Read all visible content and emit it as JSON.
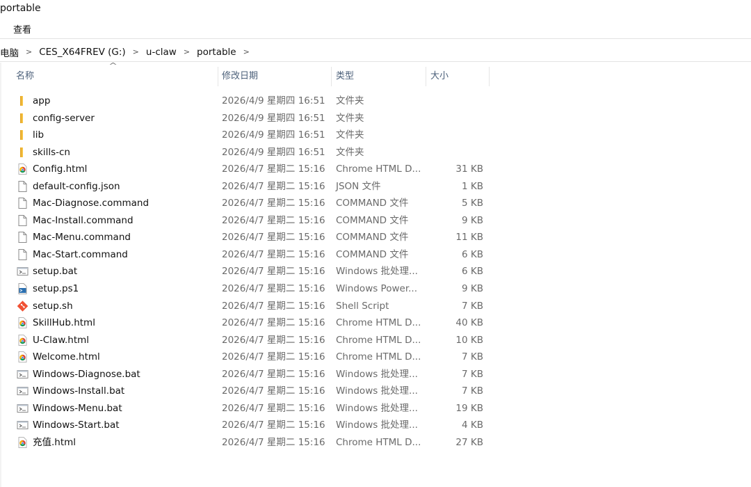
{
  "window": {
    "title": "portable"
  },
  "ribbon": {
    "view_tab": "查看"
  },
  "breadcrumb": [
    "电脑",
    "CES_X64FREV (G:)",
    "u-claw",
    "portable"
  ],
  "columns": {
    "name": "名称",
    "date": "修改日期",
    "type": "类型",
    "size": "大小"
  },
  "files": [
    {
      "name": "app",
      "date": "2026/4/9 星期四 16:51",
      "type": "文件夹",
      "size": "",
      "icon": "folder-icon"
    },
    {
      "name": "config-server",
      "date": "2026/4/9 星期四 16:51",
      "type": "文件夹",
      "size": "",
      "icon": "folder-icon"
    },
    {
      "name": "lib",
      "date": "2026/4/9 星期四 16:51",
      "type": "文件夹",
      "size": "",
      "icon": "folder-icon"
    },
    {
      "name": "skills-cn",
      "date": "2026/4/9 星期四 16:51",
      "type": "文件夹",
      "size": "",
      "icon": "folder-icon"
    },
    {
      "name": "Config.html",
      "date": "2026/4/7 星期二 15:16",
      "type": "Chrome HTML D...",
      "size": "31 KB",
      "icon": "chrome-icon"
    },
    {
      "name": "default-config.json",
      "date": "2026/4/7 星期二 15:16",
      "type": "JSON 文件",
      "size": "1 KB",
      "icon": "file-icon"
    },
    {
      "name": "Mac-Diagnose.command",
      "date": "2026/4/7 星期二 15:16",
      "type": "COMMAND 文件",
      "size": "5 KB",
      "icon": "file-icon"
    },
    {
      "name": "Mac-Install.command",
      "date": "2026/4/7 星期二 15:16",
      "type": "COMMAND 文件",
      "size": "9 KB",
      "icon": "file-icon"
    },
    {
      "name": "Mac-Menu.command",
      "date": "2026/4/7 星期二 15:16",
      "type": "COMMAND 文件",
      "size": "11 KB",
      "icon": "file-icon"
    },
    {
      "name": "Mac-Start.command",
      "date": "2026/4/7 星期二 15:16",
      "type": "COMMAND 文件",
      "size": "6 KB",
      "icon": "file-icon"
    },
    {
      "name": "setup.bat",
      "date": "2026/4/7 星期二 15:16",
      "type": "Windows 批处理...",
      "size": "6 KB",
      "icon": "batch-icon"
    },
    {
      "name": "setup.ps1",
      "date": "2026/4/7 星期二 15:16",
      "type": "Windows Power...",
      "size": "9 KB",
      "icon": "powershell-icon"
    },
    {
      "name": "setup.sh",
      "date": "2026/4/7 星期二 15:16",
      "type": "Shell Script",
      "size": "7 KB",
      "icon": "git-icon"
    },
    {
      "name": "SkillHub.html",
      "date": "2026/4/7 星期二 15:16",
      "type": "Chrome HTML D...",
      "size": "40 KB",
      "icon": "chrome-icon"
    },
    {
      "name": "U-Claw.html",
      "date": "2026/4/7 星期二 15:16",
      "type": "Chrome HTML D...",
      "size": "10 KB",
      "icon": "chrome-icon"
    },
    {
      "name": "Welcome.html",
      "date": "2026/4/7 星期二 15:16",
      "type": "Chrome HTML D...",
      "size": "7 KB",
      "icon": "chrome-icon"
    },
    {
      "name": "Windows-Diagnose.bat",
      "date": "2026/4/7 星期二 15:16",
      "type": "Windows 批处理...",
      "size": "7 KB",
      "icon": "batch-icon"
    },
    {
      "name": "Windows-Install.bat",
      "date": "2026/4/7 星期二 15:16",
      "type": "Windows 批处理...",
      "size": "7 KB",
      "icon": "batch-icon"
    },
    {
      "name": "Windows-Menu.bat",
      "date": "2026/4/7 星期二 15:16",
      "type": "Windows 批处理...",
      "size": "19 KB",
      "icon": "batch-icon"
    },
    {
      "name": "Windows-Start.bat",
      "date": "2026/4/7 星期二 15:16",
      "type": "Windows 批处理...",
      "size": "4 KB",
      "icon": "batch-icon"
    },
    {
      "name": "充值.html",
      "date": "2026/4/7 星期二 15:16",
      "type": "Chrome HTML D...",
      "size": "27 KB",
      "icon": "chrome-icon"
    }
  ],
  "colors": {
    "folder": "#f6c343",
    "header_text": "#4c607a",
    "meta_text": "#6a6a6a"
  }
}
